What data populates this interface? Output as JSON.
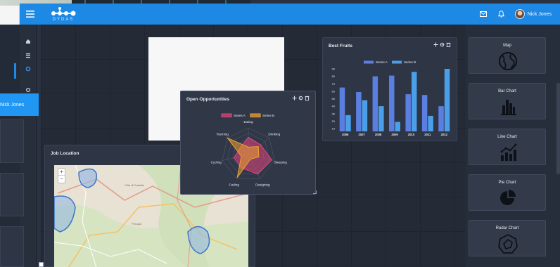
{
  "brand": {
    "name": "DYDAS"
  },
  "header": {
    "user_name": "Nick Jones",
    "mail_icon": "mail-icon",
    "bell_icon": "bell-icon"
  },
  "sidebar": {
    "user_name": "Nick Jones",
    "items": [
      "home-icon",
      "list-icon",
      "settings-icon",
      "power-icon"
    ]
  },
  "panels": {
    "open_opportunities": {
      "title": "Open Opportunities"
    },
    "best_fruits": {
      "title": "Best Fruits"
    },
    "job_location": {
      "title": "Job Location"
    }
  },
  "tool_icons": [
    "move-icon",
    "settings-icon",
    "delete-icon"
  ],
  "widgets": [
    {
      "label": "Map",
      "icon": "globe-icon"
    },
    {
      "label": "Bar Chart",
      "icon": "bar-chart-icon"
    },
    {
      "label": "Line Chart",
      "icon": "line-chart-icon"
    },
    {
      "label": "Pie Chart",
      "icon": "pie-chart-icon"
    },
    {
      "label": "Radar Chart",
      "icon": "radar-chart-icon"
    }
  ],
  "colors": {
    "topbar": "#1e88e5",
    "series_a_radar": "#e0457b",
    "series_b_radar": "#f0a030",
    "series_a_bar": "#5b7fe0",
    "series_b_bar": "#4a9fe8"
  },
  "chart_data": [
    {
      "type": "bar",
      "title": "Best Fruits",
      "categories": [
        "2006",
        "2007",
        "2008",
        "2009",
        "2010",
        "2011",
        "2012"
      ],
      "series": [
        {
          "name": "Series A",
          "values": [
            65,
            59,
            80,
            81,
            56,
            55,
            40
          ]
        },
        {
          "name": "Series B",
          "values": [
            28,
            48,
            40,
            19,
            86,
            27,
            90
          ]
        }
      ],
      "yticks": [
        "10",
        "20",
        "30",
        "40",
        "50",
        "60",
        "70",
        "80",
        "90"
      ],
      "ylim": [
        10,
        90
      ],
      "legend": "top-center",
      "grid": false
    },
    {
      "type": "radar",
      "title": "Open Opportunities",
      "axes": [
        "Eating",
        "Drinking",
        "Sleeping",
        "Designing",
        "Coding",
        "Cycling",
        "Running"
      ],
      "series": [
        {
          "name": "Series A",
          "values": [
            65,
            59,
            90,
            81,
            56,
            55,
            40
          ]
        },
        {
          "name": "Series B",
          "values": [
            28,
            48,
            40,
            19,
            96,
            27,
            100
          ]
        }
      ],
      "rlim": [
        0,
        100
      ],
      "legend": "top-center"
    }
  ]
}
